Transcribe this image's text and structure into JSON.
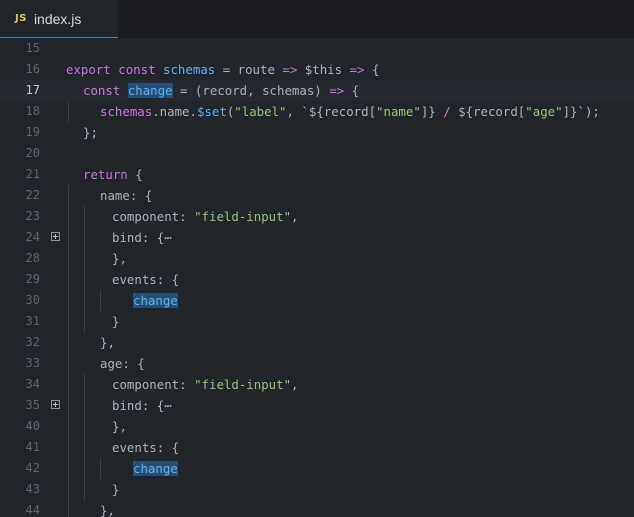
{
  "tab": {
    "icon": "JS",
    "label": "index.js"
  },
  "lines": [
    {
      "num": "15",
      "indent": 0,
      "tokens": []
    },
    {
      "num": "16",
      "indent": 0,
      "tokens": [
        {
          "t": "export",
          "c": "kw"
        },
        {
          "t": " "
        },
        {
          "t": "const",
          "c": "kw"
        },
        {
          "t": " "
        },
        {
          "t": "schemas",
          "c": "fn"
        },
        {
          "t": " = "
        },
        {
          "t": "route",
          "c": "pr"
        },
        {
          "t": " "
        },
        {
          "t": "=>",
          "c": "op"
        },
        {
          "t": " "
        },
        {
          "t": "$this",
          "c": "pr"
        },
        {
          "t": " "
        },
        {
          "t": "=>",
          "c": "op"
        },
        {
          "t": " {"
        }
      ]
    },
    {
      "num": "17",
      "indent": 1,
      "current": true,
      "tokens": [
        {
          "t": "const",
          "c": "kw"
        },
        {
          "t": " "
        },
        {
          "t": "change",
          "c": "hl"
        },
        {
          "t": " = (record, schemas) "
        },
        {
          "t": "=>",
          "c": "op"
        },
        {
          "t": " {"
        }
      ]
    },
    {
      "num": "18",
      "indent": 2,
      "tokens": [
        {
          "t": "schemas",
          "c": "kw"
        },
        {
          "t": ".name."
        },
        {
          "t": "$set",
          "c": "fn"
        },
        {
          "t": "("
        },
        {
          "t": "\"label\"",
          "c": "st"
        },
        {
          "t": ", `${record["
        },
        {
          "t": "\"name\"",
          "c": "st"
        },
        {
          "t": "]} "
        },
        {
          "t": "/",
          "c": "op"
        },
        {
          "t": " ${record["
        },
        {
          "t": "\"age\"",
          "c": "st"
        },
        {
          "t": "]}`);"
        }
      ]
    },
    {
      "num": "19",
      "indent": 1,
      "tokens": [
        {
          "t": "};"
        }
      ]
    },
    {
      "num": "20",
      "indent": 0,
      "tokens": []
    },
    {
      "num": "21",
      "indent": 1,
      "tokens": [
        {
          "t": "return",
          "c": "kw"
        },
        {
          "t": " {"
        }
      ]
    },
    {
      "num": "22",
      "indent": 2,
      "tokens": [
        {
          "t": "name: {"
        }
      ]
    },
    {
      "num": "23",
      "indent": 3,
      "tokens": [
        {
          "t": "component: "
        },
        {
          "t": "\"field-input\"",
          "c": "st"
        },
        {
          "t": ","
        }
      ]
    },
    {
      "num": "24",
      "indent": 3,
      "fold": true,
      "tokens": [
        {
          "t": "bind: {"
        },
        {
          "t": "⋯",
          "c": "fold-dots"
        }
      ]
    },
    {
      "num": "28",
      "indent": 3,
      "tokens": [
        {
          "t": "},"
        }
      ]
    },
    {
      "num": "29",
      "indent": 3,
      "tokens": [
        {
          "t": "events: {"
        }
      ]
    },
    {
      "num": "30",
      "indent": 4,
      "tokens": [
        {
          "t": "change",
          "c": "hl"
        }
      ]
    },
    {
      "num": "31",
      "indent": 3,
      "tokens": [
        {
          "t": "}"
        }
      ]
    },
    {
      "num": "32",
      "indent": 2,
      "tokens": [
        {
          "t": "},"
        }
      ]
    },
    {
      "num": "33",
      "indent": 2,
      "tokens": [
        {
          "t": "age: {"
        }
      ]
    },
    {
      "num": "34",
      "indent": 3,
      "tokens": [
        {
          "t": "component: "
        },
        {
          "t": "\"field-input\"",
          "c": "st"
        },
        {
          "t": ","
        }
      ]
    },
    {
      "num": "35",
      "indent": 3,
      "fold": true,
      "tokens": [
        {
          "t": "bind: {"
        },
        {
          "t": "⋯",
          "c": "fold-dots"
        }
      ]
    },
    {
      "num": "40",
      "indent": 3,
      "tokens": [
        {
          "t": "},"
        }
      ]
    },
    {
      "num": "41",
      "indent": 3,
      "tokens": [
        {
          "t": "events: {"
        }
      ]
    },
    {
      "num": "42",
      "indent": 4,
      "tokens": [
        {
          "t": "change",
          "c": "hl"
        }
      ]
    },
    {
      "num": "43",
      "indent": 3,
      "tokens": [
        {
          "t": "}"
        }
      ]
    },
    {
      "num": "44",
      "indent": 2,
      "tokens": [
        {
          "t": "},"
        }
      ]
    }
  ]
}
